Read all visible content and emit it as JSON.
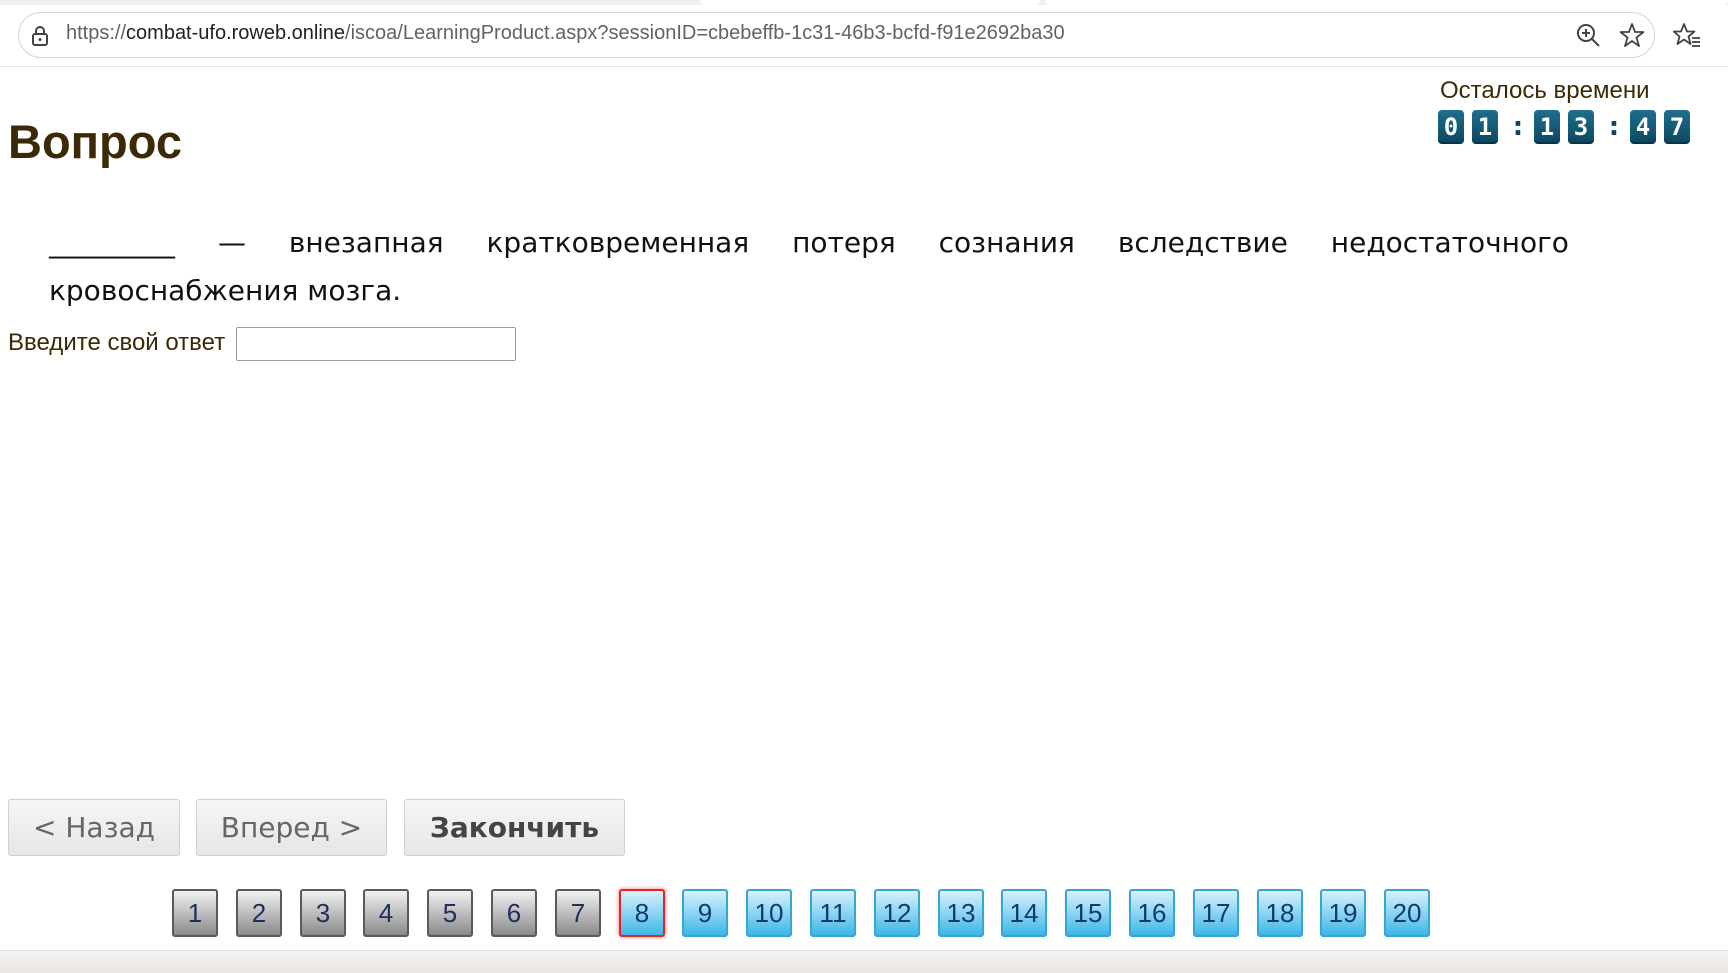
{
  "browser": {
    "url_prefix": "https://",
    "url_host": "combat-ufo.roweb.online",
    "url_path": "/iscoa/LearningProduct.aspx?sessionID=cbebeffb-1c31-46b3-bcfd-f91e2692ba30"
  },
  "header": {
    "title": "Вопрос",
    "timer_label": "Осталось времени",
    "timer_digits": [
      "0",
      "1",
      "1",
      "3",
      "4",
      "7"
    ],
    "timer_separator": ":"
  },
  "question": {
    "line1_words": [
      "_________",
      "—",
      "внезапная",
      "кратковременная",
      "потеря",
      "сознания",
      "вследствие",
      "недостаточного"
    ],
    "line2": "кровоснабжения мозга.",
    "answer_label": "Введите свой ответ",
    "answer_value": ""
  },
  "navigation": {
    "back_label": "< Назад",
    "forward_label": "Вперед >",
    "finish_label": "Закончить"
  },
  "pager": {
    "pages": [
      "1",
      "2",
      "3",
      "4",
      "5",
      "6",
      "7",
      "8",
      "9",
      "10",
      "11",
      "12",
      "13",
      "14",
      "15",
      "16",
      "17",
      "18",
      "19",
      "20"
    ],
    "current": 8,
    "answered_through": 7
  }
}
